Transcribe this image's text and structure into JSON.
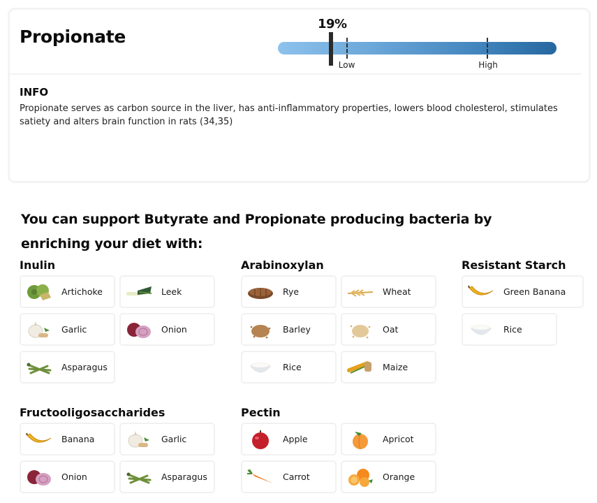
{
  "metric": {
    "title": "Propionate",
    "value_label": "19%",
    "value_fraction": 0.19,
    "low_fraction": 0.245,
    "high_fraction": 0.75,
    "low_label": "Low",
    "high_label": "High",
    "bar_colors": {
      "start": "#8dc2ec",
      "end": "#26679f",
      "marker": "#2b2b2b"
    }
  },
  "info": {
    "heading": "INFO",
    "text": "Propionate serves as carbon source in the liver, has anti-inflammatory properties, lowers blood cholesterol, stimulates satiety and alters brain function in rats (34,35)"
  },
  "support": {
    "heading": "You can support Butyrate and Propionate producing bacteria by enriching your diet with:"
  },
  "groups": [
    {
      "title": "Inulin",
      "items": [
        {
          "label": "Artichoke",
          "icon": "artichoke-icon"
        },
        {
          "label": "Leek",
          "icon": "leek-icon"
        },
        {
          "label": "Garlic",
          "icon": "garlic-icon"
        },
        {
          "label": "Onion",
          "icon": "onion-icon"
        },
        {
          "label": "Asparagus",
          "icon": "asparagus-icon"
        }
      ]
    },
    {
      "title": "Arabinoxylan",
      "items": [
        {
          "label": "Rye",
          "icon": "rye-bread-icon"
        },
        {
          "label": "Wheat",
          "icon": "wheat-icon"
        },
        {
          "label": "Barley",
          "icon": "barley-icon"
        },
        {
          "label": "Oat",
          "icon": "oat-icon"
        },
        {
          "label": "Rice",
          "icon": "rice-icon"
        },
        {
          "label": "Maize",
          "icon": "maize-icon"
        }
      ]
    },
    {
      "title": "Resistant Starch",
      "items": [
        {
          "label": "Green Banana",
          "icon": "banana-icon"
        },
        {
          "label": "Rice",
          "icon": "rice-icon"
        }
      ]
    },
    {
      "title": "Fructooligosaccharides",
      "items": [
        {
          "label": "Banana",
          "icon": "banana-icon"
        },
        {
          "label": "Garlic",
          "icon": "garlic-icon"
        },
        {
          "label": "Onion",
          "icon": "onion-icon"
        },
        {
          "label": "Asparagus",
          "icon": "asparagus-icon"
        }
      ]
    },
    {
      "title": "Pectin",
      "items": [
        {
          "label": "Apple",
          "icon": "apple-icon"
        },
        {
          "label": "Apricot",
          "icon": "apricot-icon"
        },
        {
          "label": "Carrot",
          "icon": "carrot-icon"
        },
        {
          "label": "Orange",
          "icon": "orange-icon"
        }
      ]
    }
  ]
}
